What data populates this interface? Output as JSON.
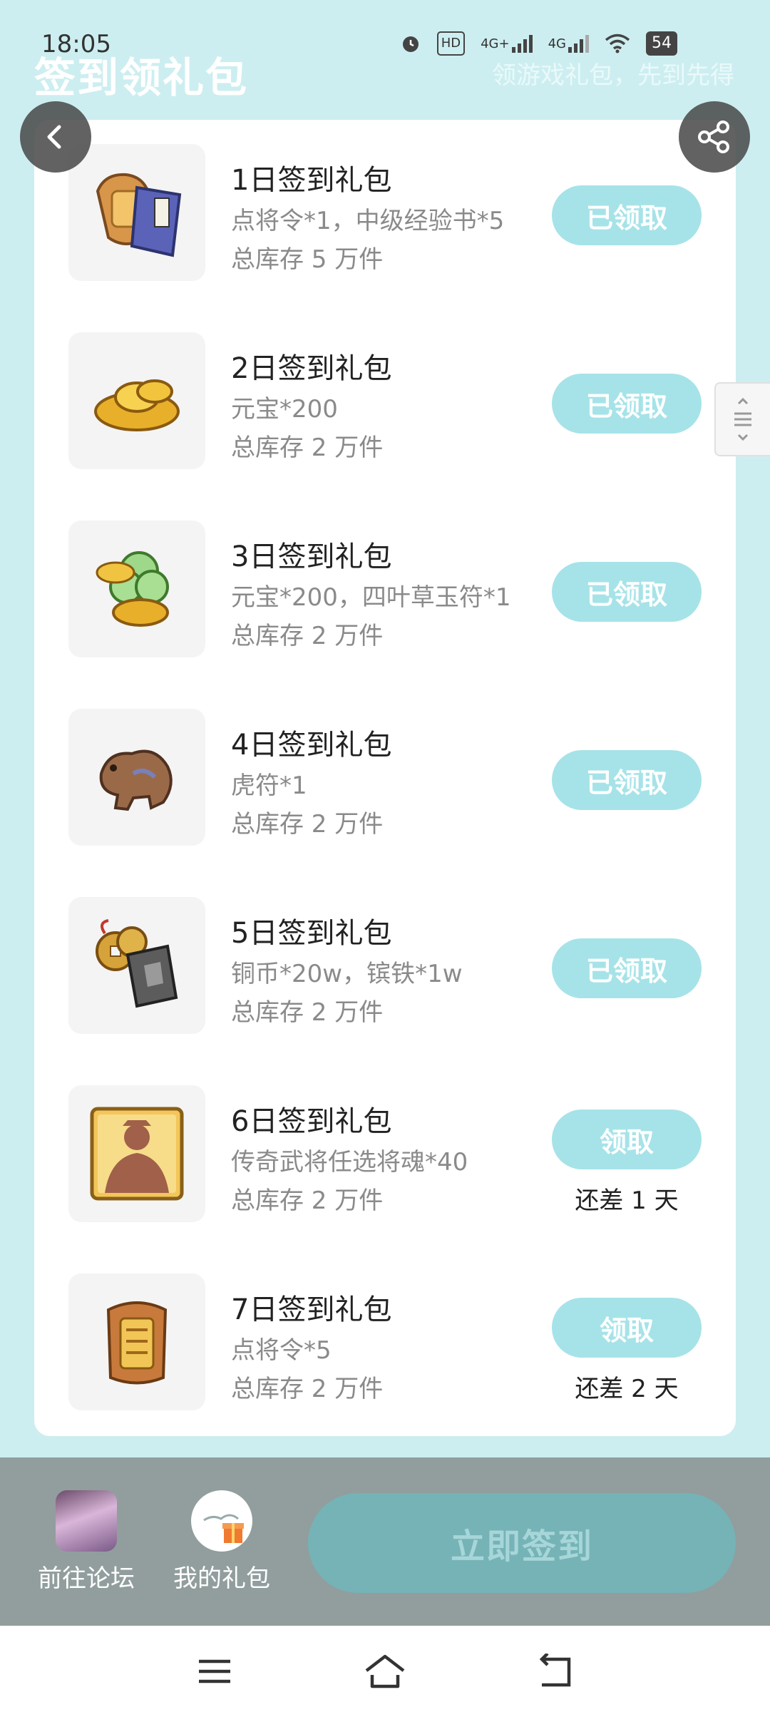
{
  "status_bar": {
    "time": "18:05",
    "network_label": "HD",
    "sim1": "4G+",
    "sim2": "4G",
    "battery": "54"
  },
  "header": {
    "title": "签到领礼包",
    "subtitle": "领游戏礼包，先到先得"
  },
  "gifts": [
    {
      "title": "1日签到礼包",
      "desc": "点将令*1，中级经验书*5",
      "stock": "总库存 5 万件",
      "button": "已领取",
      "remain": "",
      "icon": "token-and-book-icon"
    },
    {
      "title": "2日签到礼包",
      "desc": "元宝*200",
      "stock": "总库存 2 万件",
      "button": "已领取",
      "remain": "",
      "icon": "gold-ingot-icon"
    },
    {
      "title": "3日签到礼包",
      "desc": "元宝*200，四叶草玉符*1",
      "stock": "总库存 2 万件",
      "button": "已领取",
      "remain": "",
      "icon": "ingot-clover-jade-icon"
    },
    {
      "title": "4日签到礼包",
      "desc": "虎符*1",
      "stock": "总库存 2 万件",
      "button": "已领取",
      "remain": "",
      "icon": "tiger-tally-icon"
    },
    {
      "title": "5日签到礼包",
      "desc": "铜币*20w，镔铁*1w",
      "stock": "总库存 2 万件",
      "button": "已领取",
      "remain": "",
      "icon": "coins-and-iron-icon"
    },
    {
      "title": "6日签到礼包",
      "desc": "传奇武将任选将魂*40",
      "stock": "总库存 2 万件",
      "button": "领取",
      "remain": "还差 1 天",
      "icon": "general-soul-card-icon"
    },
    {
      "title": "7日签到礼包",
      "desc": "点将令*5",
      "stock": "总库存 2 万件",
      "button": "领取",
      "remain": "还差 2 天",
      "icon": "command-token-icon"
    }
  ],
  "bottom": {
    "forum_label": "前往论坛",
    "my_gifts_label": "我的礼包",
    "checkin_label": "立即签到"
  },
  "colors": {
    "background": "#cdeef0",
    "button": "#a6e3e8",
    "bottom_bar": "#919e9d",
    "checkin_button": "#75b3b7"
  }
}
